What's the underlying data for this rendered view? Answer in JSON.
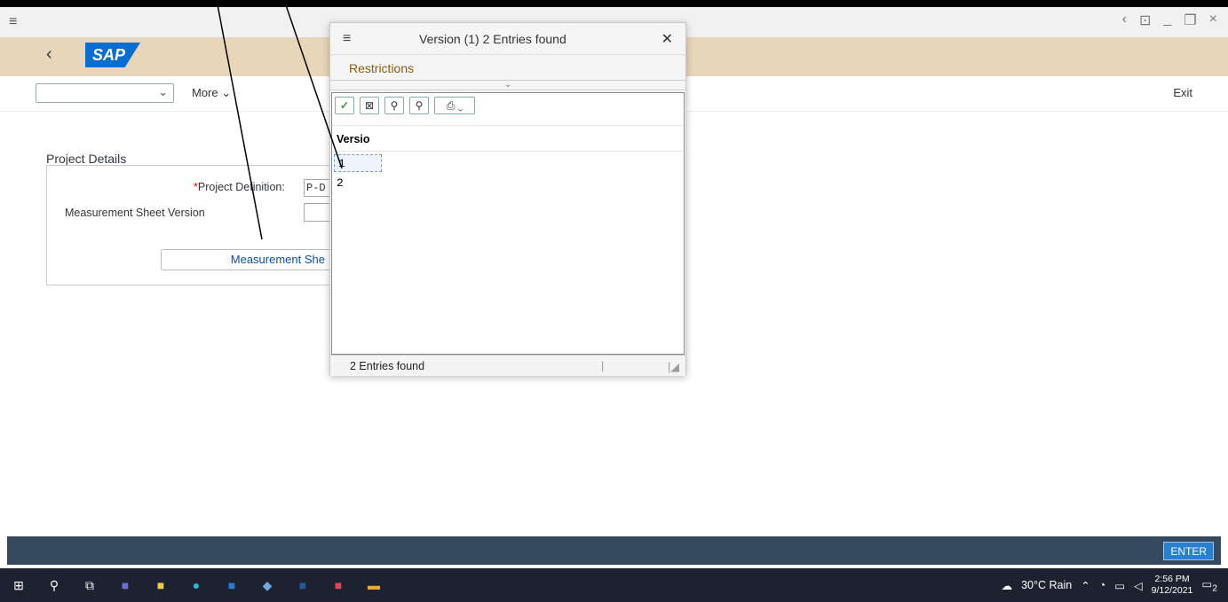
{
  "dialog": {
    "title": "Version (1)  2 Entries found",
    "restrictions": "Restrictions",
    "column_header": "Versio",
    "rows": [
      "1",
      "2"
    ],
    "status": "2 Entries found"
  },
  "toolbar": {
    "more_label": "More",
    "exit_label": "Exit"
  },
  "form": {
    "section_title": "Project Details",
    "project_definition_label": "Project Definition:",
    "project_definition_value": "P-D",
    "measurement_version_label": "Measurement Sheet Version",
    "measurement_button_label": "Measurement She"
  },
  "logo": {
    "text": "SAP"
  },
  "footer": {
    "enter_label": "ENTER"
  },
  "taskbar": {
    "weather": "30°C  Rain",
    "time": "2:56 PM",
    "date": "9/12/2021",
    "notif_count": "2"
  },
  "colors": {
    "shell": "#e8d6ba",
    "accent": "#0a6ed1",
    "footer": "#354a5f"
  }
}
